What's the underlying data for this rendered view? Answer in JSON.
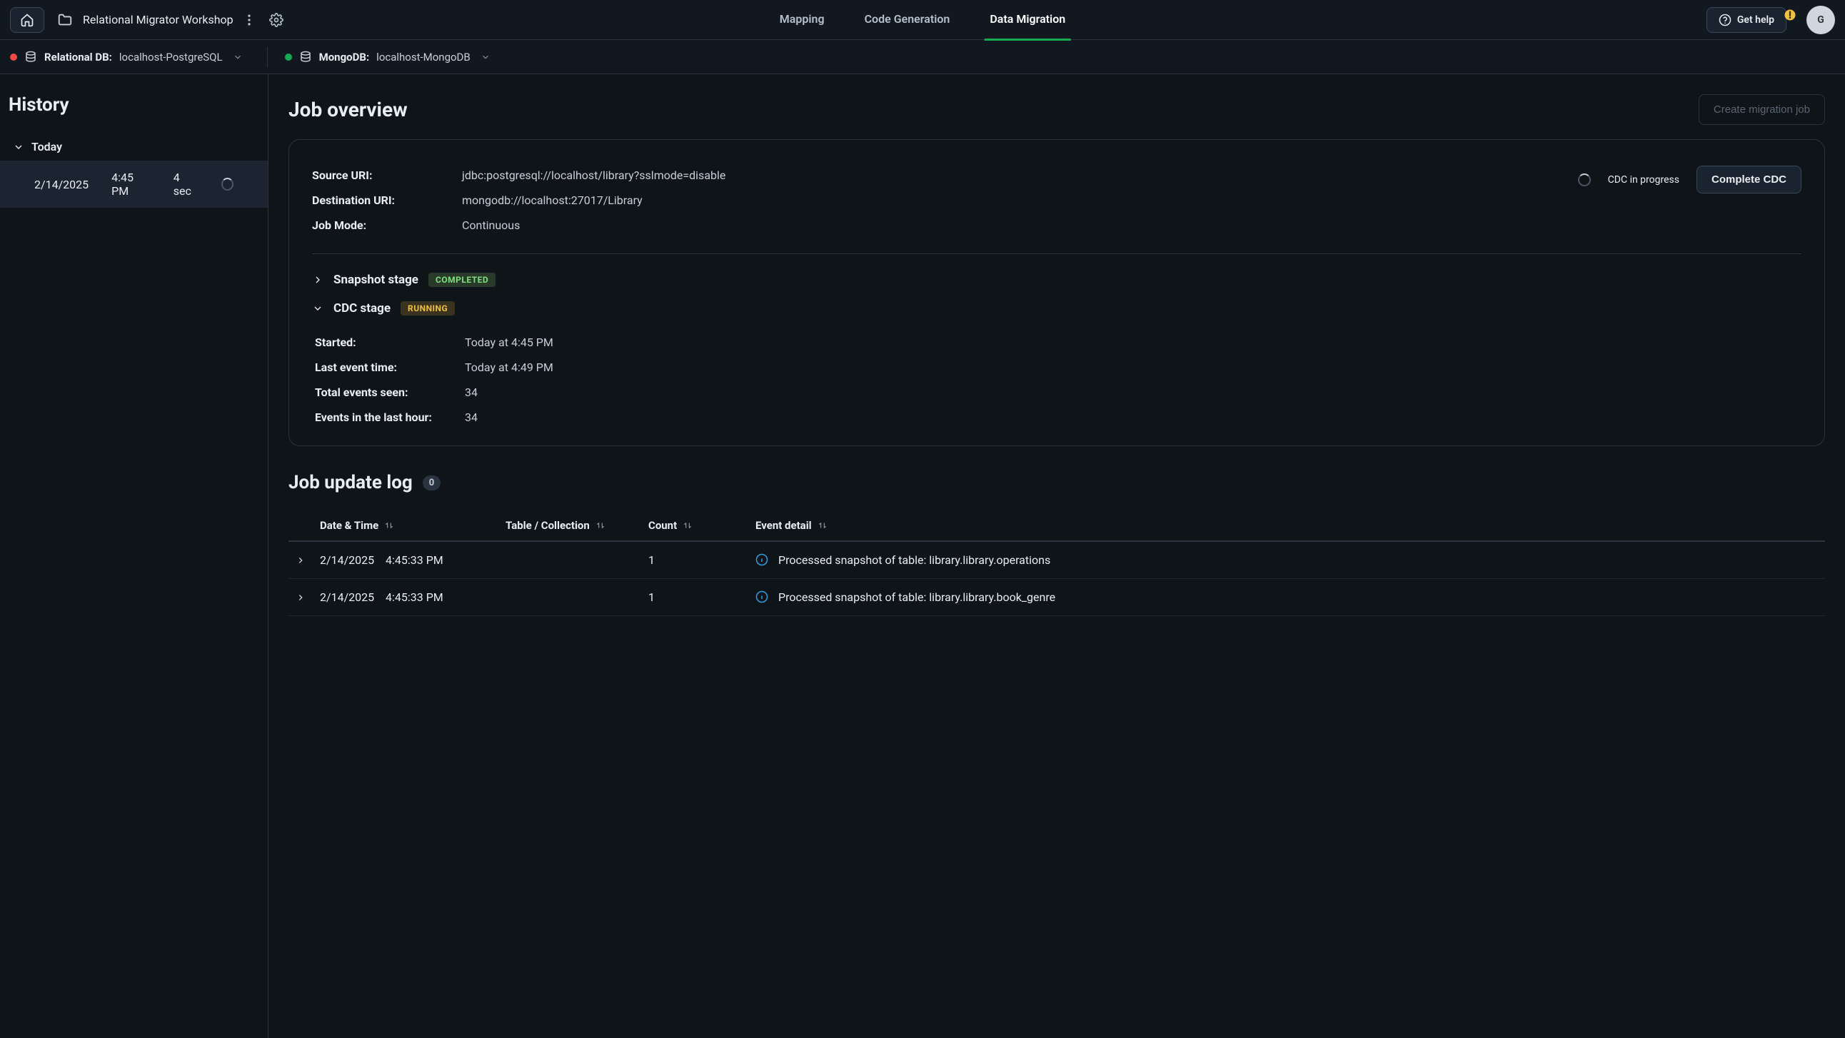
{
  "header": {
    "project_name": "Relational Migrator Workshop",
    "tabs": [
      {
        "label": "Mapping",
        "active": false
      },
      {
        "label": "Code Generation",
        "active": false
      },
      {
        "label": "Data Migration",
        "active": true
      }
    ],
    "get_help": "Get help",
    "avatar_initial": "G"
  },
  "dbbar": {
    "relational_label": "Relational DB:",
    "relational_value": "localhost-PostgreSQL",
    "mongo_label": "MongoDB:",
    "mongo_value": "localhost-MongoDB"
  },
  "sidebar": {
    "title": "History",
    "today_label": "Today",
    "items": [
      {
        "date": "2/14/2025",
        "time": "4:45 PM",
        "duration": "4 sec"
      }
    ]
  },
  "overview": {
    "title": "Job overview",
    "create_label": "Create migration job",
    "source_uri_label": "Source URI:",
    "source_uri_value": "jdbc:postgresql://localhost/library?sslmode=disable",
    "destination_uri_label": "Destination URI:",
    "destination_uri_value": "mongodb://localhost:27017/Library",
    "job_mode_label": "Job Mode:",
    "job_mode_value": "Continuous",
    "cdc_status_text": "CDC in progress",
    "complete_cdc_label": "Complete CDC",
    "snapshot_stage_label": "Snapshot stage",
    "snapshot_badge": "COMPLETED",
    "cdc_stage_label": "CDC stage",
    "cdc_badge": "RUNNING",
    "cdc": {
      "started_label": "Started:",
      "started_value": "Today at 4:45 PM",
      "last_event_label": "Last event time:",
      "last_event_value": "Today at 4:49 PM",
      "total_events_label": "Total events seen:",
      "total_events_value": "34",
      "events_last_hour_label": "Events in the last hour:",
      "events_last_hour_value": "34"
    }
  },
  "log": {
    "title": "Job update log",
    "count_badge": "0",
    "columns": {
      "datetime": "Date & Time",
      "table_collection": "Table / Collection",
      "count": "Count",
      "event_detail": "Event detail"
    },
    "rows": [
      {
        "date": "2/14/2025",
        "time": "4:45:33 PM",
        "table": "",
        "count": "1",
        "detail": "Processed snapshot of table: library.library.operations"
      },
      {
        "date": "2/14/2025",
        "time": "4:45:33 PM",
        "table": "",
        "count": "1",
        "detail": "Processed snapshot of table: library.library.book_genre"
      }
    ]
  }
}
